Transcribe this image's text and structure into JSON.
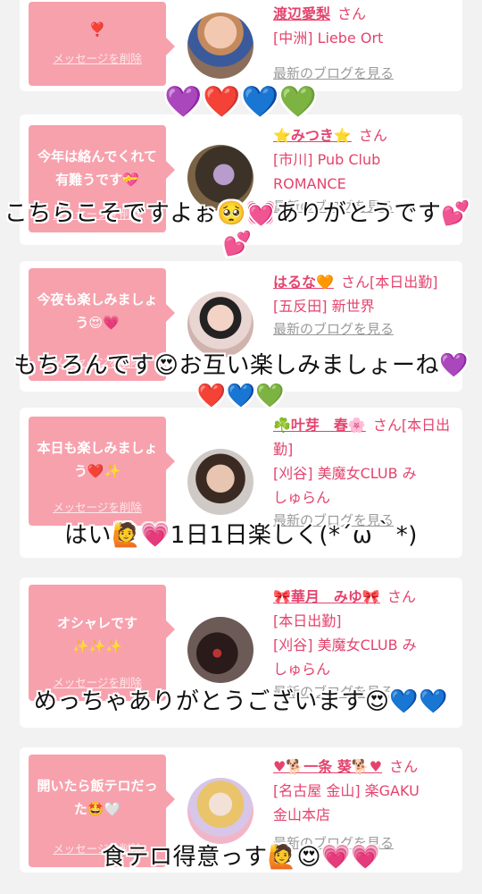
{
  "delete_label": "メッセージを削除",
  "blog_label": "最新のブログを見る",
  "san": "さん",
  "cards": [
    {
      "message": "❣️",
      "name": "渡辺愛梨",
      "status": "",
      "shop_lines": [
        "[中洲] Liebe Ort"
      ]
    },
    {
      "message": "今年は絡んでくれて有難うです💝",
      "name": "⭐みつき⭐",
      "status": "",
      "shop_lines": [
        "[市川] Pub Club",
        "ROMANCE"
      ]
    },
    {
      "message": "今夜も楽しみましょう😍💗",
      "name": "はるな🧡",
      "status": "[本日出勤]",
      "shop_lines": [
        "[五反田] 新世界"
      ]
    },
    {
      "message": "本日も楽しみましょう❤️✨",
      "name": "☘️叶芽　春🌸",
      "status": "[本日出勤]",
      "shop_lines": [
        "[刈谷] 美魔女CLUB み",
        "しゅらん"
      ]
    },
    {
      "message": "オシャレです✨✨✨",
      "name": "🎀華月　みゆ🎀",
      "status": "[本日出勤]",
      "shop_lines": [
        "[刈谷] 美魔女CLUB み",
        "しゅらん"
      ]
    },
    {
      "message": "開いたら飯テロだった🤩🤍",
      "name": "♥🐕一条 葵🐕♥",
      "status": "",
      "shop_lines": [
        "[名古屋 金山] 楽GAKU",
        "金山本店"
      ]
    }
  ],
  "captions": [
    {
      "text": "💜❤️💙💚"
    },
    {
      "text": "こちらこそですよぉ🥺💓ありがとうです💕💕"
    },
    {
      "text": "もちろんです😍お互い楽しみましょーね💜❤️💙💚"
    },
    {
      "text": "はい🙋💗1日1日楽しく(*´ω｀*)"
    },
    {
      "text": "めっちゃありがとうございます😍💙💙"
    },
    {
      "text": "食テロ得意っす🙋😍💗💗"
    }
  ]
}
